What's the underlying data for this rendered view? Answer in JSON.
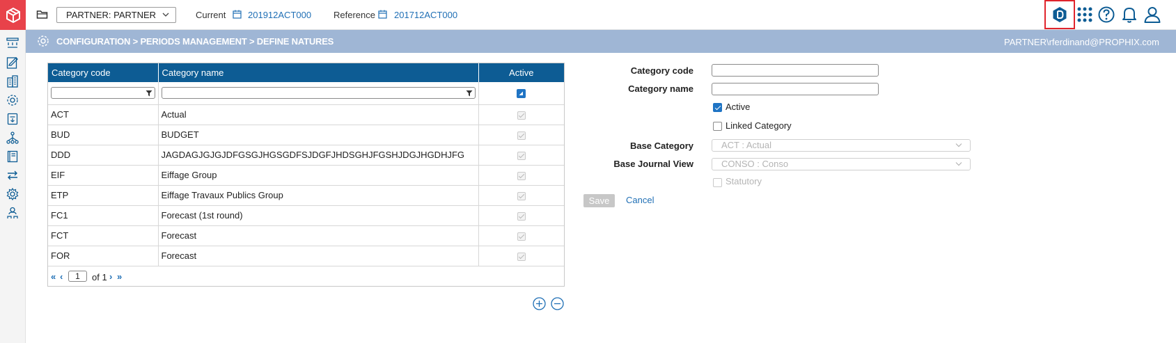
{
  "header": {
    "partner_select": "PARTNER: PARTNER",
    "current_label": "Current",
    "current_value": "201912ACT000",
    "reference_label": "Reference",
    "reference_value": "201712ACT000",
    "icons": [
      "prophix-logo-icon",
      "folder-icon",
      "calendar-icon",
      "badge-icon",
      "apps-grid-icon",
      "help-icon",
      "bell-icon",
      "user-icon"
    ]
  },
  "sidebar": {
    "icons": [
      "process-icon",
      "edit-form-icon",
      "building-icon",
      "gear-network-icon",
      "report-icon",
      "hierarchy-icon",
      "book-icon",
      "transfer-icon",
      "settings-icon",
      "users-icon"
    ]
  },
  "breadcrumb": {
    "part1": "CONFIGURATION",
    "sep": " > ",
    "part2": "PERIODS MANAGEMENT",
    "part3": "DEFINE NATURES",
    "user": "PARTNER\\rferdinand@PROPHIX.com"
  },
  "table": {
    "columns": [
      "Category code",
      "Category name",
      "Active"
    ],
    "rows": [
      {
        "code": "ACT",
        "name": "Actual",
        "active": true
      },
      {
        "code": "BUD",
        "name": "BUDGET",
        "active": true
      },
      {
        "code": "DDD",
        "name": "JAGDAGJGJGJDFGSGJHGSGDFSJDGFJHDSGHJFGSHJDGJHGDHJFG",
        "active": true
      },
      {
        "code": "EIF",
        "name": "Eiffage Group",
        "active": true
      },
      {
        "code": "ETP",
        "name": "Eiffage Travaux Publics Group",
        "active": true
      },
      {
        "code": "FC1",
        "name": "Forecast (1st round)",
        "active": true
      },
      {
        "code": "FCT",
        "name": "Forecast",
        "active": true
      },
      {
        "code": "FOR",
        "name": "Forecast",
        "active": true
      }
    ],
    "pager": {
      "first": "«",
      "prev": "‹",
      "page": "1",
      "of_label": "of 1",
      "next": "›",
      "last": "»"
    }
  },
  "form": {
    "category_code_label": "Category code",
    "category_code_value": "",
    "category_name_label": "Category name",
    "category_name_value": "",
    "active_label": "Active",
    "active_checked": true,
    "linked_label": "Linked Category",
    "linked_checked": false,
    "base_category_label": "Base Category",
    "base_category_value": "ACT : Actual",
    "base_journal_label": "Base Journal View",
    "base_journal_value": "CONSO : Conso",
    "statutory_label": "Statutory",
    "save_label": "Save",
    "cancel_label": "Cancel"
  },
  "colors": {
    "brand": "#e8424a",
    "header_band": "#9fb6d5",
    "table_header": "#0d5c94",
    "link": "#1f6fb5",
    "highlight": "#e0242c"
  }
}
